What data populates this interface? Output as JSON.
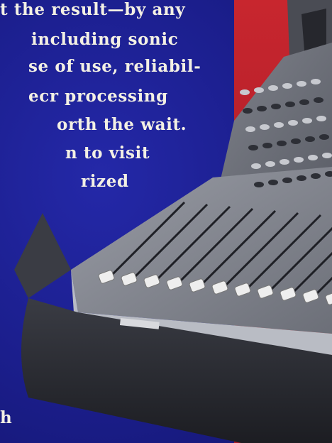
{
  "ad": {
    "copy_lines": [
      "t the result—by any",
      "including sonic",
      "se of use, reliabil-",
      "ecr processing",
      "orth the wait.",
      "n to visit",
      "rized",
      "h"
    ]
  },
  "colors": {
    "background_blue": "#1b1e8c",
    "background_red": "#b01e2a",
    "text": "#f3f0e4",
    "console_body": "#2c2e36",
    "console_surface": "#8a8d96",
    "fader_cap": "#eeeeee"
  },
  "icons": [
    "mixing-console-image"
  ]
}
